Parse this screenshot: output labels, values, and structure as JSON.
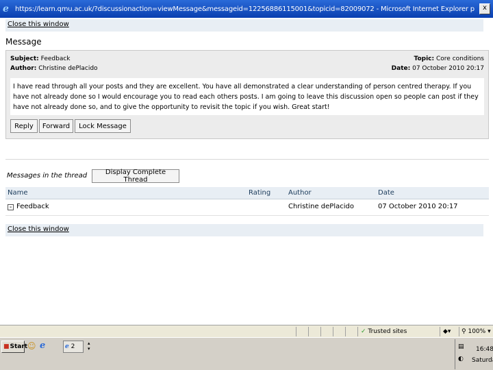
{
  "window": {
    "title": "https://learn.qmu.ac.uk/?discussionaction=viewMessage&messageid=12256886115001&topicid=82009072 - Microsoft Internet Explorer p",
    "controls": {
      "close": "x"
    }
  },
  "top_link": {
    "label": "Close this window"
  },
  "message": {
    "heading": "Message",
    "subject_label": "Subject:",
    "subject_value": "Feedback",
    "author_label": "Author:",
    "author_value": "Christine dePlacido",
    "topic_label": "Topic:",
    "topic_value": "Core conditions",
    "date_label": "Date:",
    "date_value": "07 October 2010 20:17",
    "body": "I have read through all your posts and they are excellent. You have all demonstrated a clear understanding of person centred therapy. If you have not already done so I would encourage you to read each others posts. I am going to leave this discussion open so people can post if they have not already done so, and to give the opportunity to revisit the topic if you wish. Great start!",
    "buttons": {
      "reply": "Reply",
      "forward": "Forward",
      "lock": "Lock Message"
    }
  },
  "thread": {
    "label": "Messages in the thread",
    "display_button": "Display Complete Thread",
    "columns": {
      "name": "Name",
      "rating": "Rating",
      "author": "Author",
      "date": "Date"
    },
    "rows": [
      {
        "expand": "-",
        "name": "Feedback",
        "rating": "",
        "author": "Christine dePlacido",
        "date": "07 October 2010 20:17"
      }
    ]
  },
  "bottom_link": {
    "label": "Close this window"
  },
  "status_bar": {
    "zone": "Trusted sites",
    "zoom": "100%"
  },
  "taskbar": {
    "start": "Start",
    "task": "2",
    "time": "16:48",
    "day": "Saturday"
  },
  "colors": {
    "titlebar": "#0a3fb0",
    "panel": "#ececec",
    "header_bar": "#e8eef4"
  }
}
